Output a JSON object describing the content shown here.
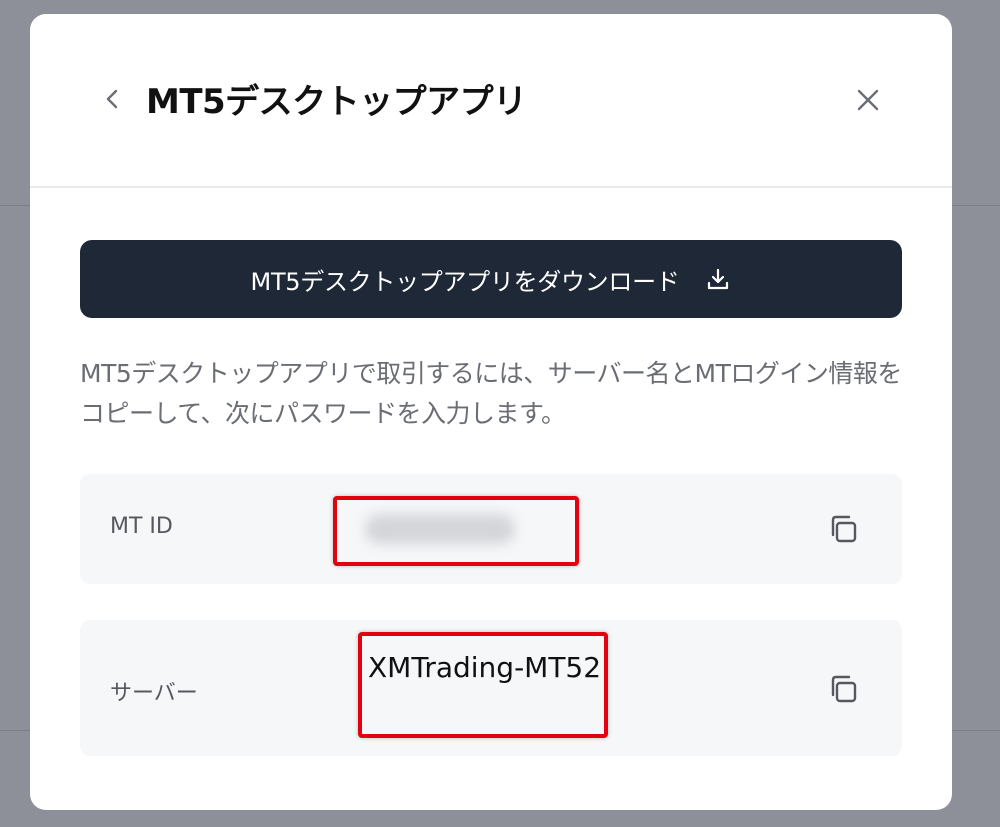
{
  "modal": {
    "title": "MT5デスクトップアプリ",
    "back_icon": "chevron-left-icon",
    "close_icon": "close-icon"
  },
  "download_button": {
    "label": "MT5デスクトップアプリをダウンロード",
    "icon": "download-icon"
  },
  "description": "MT5デスクトップアプリで取引するには、サーバー名とMTログイン情報をコピーして、次にパスワードを入力します。",
  "fields": {
    "mt_id": {
      "label": "MT ID",
      "value_hidden": true,
      "copy_icon": "copy-icon"
    },
    "server": {
      "label": "サーバー",
      "value": "XMTrading-MT52",
      "copy_icon": "copy-icon"
    }
  },
  "colors": {
    "overlay": "#8e9099",
    "modal_bg": "#ffffff",
    "button_bg": "#1f2837",
    "row_bg": "#f6f7f9",
    "highlight": "#e3000f"
  }
}
